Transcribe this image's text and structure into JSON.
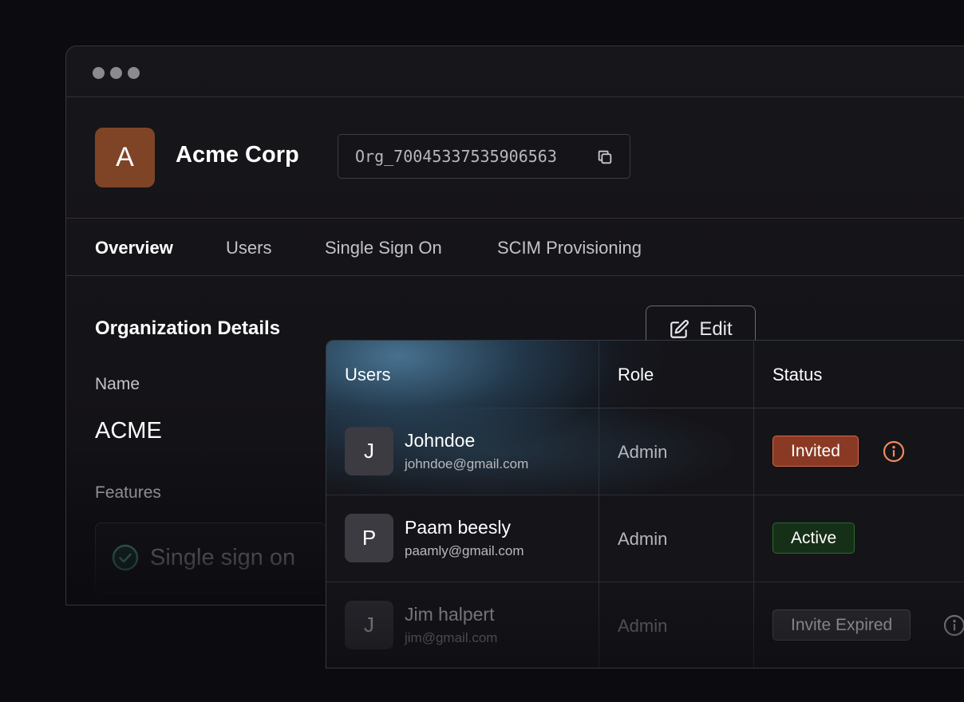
{
  "org": {
    "avatar_letter": "A",
    "name": "Acme Corp",
    "id": "Org_70045337535906563",
    "avatar_color": "#7f4426"
  },
  "tabs": [
    {
      "label": "Overview",
      "active": true
    },
    {
      "label": "Users",
      "active": false
    },
    {
      "label": "Single Sign On",
      "active": false
    },
    {
      "label": "SCIM Provisioning",
      "active": false
    }
  ],
  "details": {
    "title": "Organization Details",
    "edit_label": "Edit",
    "name_label": "Name",
    "name_value": "ACME",
    "features_label": "Features",
    "feature_sso": "Single sign on"
  },
  "users_table": {
    "headers": {
      "users": "Users",
      "role": "Role",
      "status": "Status"
    },
    "rows": [
      {
        "initial": "J",
        "name": "Johndoe",
        "email": "johndoe@gmail.com",
        "role": "Admin",
        "status": "Invited",
        "status_color": "#8a3a24"
      },
      {
        "initial": "P",
        "name": "Paam beesly",
        "email": "paamly@gmail.com",
        "role": "Admin",
        "status": "Active",
        "status_color": "#163018"
      },
      {
        "initial": "J",
        "name": "Jim halpert",
        "email": "jim@gmail.com",
        "role": "Admin",
        "status": "Invite Expired",
        "status_color": "#2b2b30"
      }
    ]
  },
  "icons": {
    "copy": "copy-icon",
    "edit": "pencil-square-icon",
    "check": "check-circle-icon",
    "info": "info-icon"
  }
}
